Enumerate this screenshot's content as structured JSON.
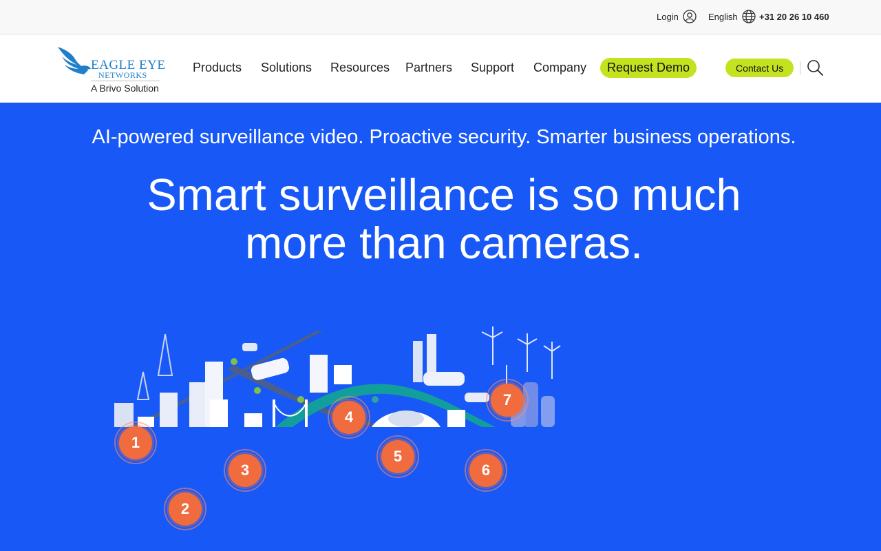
{
  "topbar": {
    "login_label": "Login",
    "language_label": "English",
    "phone": "+31 20 26 10 460"
  },
  "logo": {
    "line1": "EAGLE EYE",
    "line2": "NETWORKS",
    "line3": "A Brivo Solution"
  },
  "nav": {
    "items": [
      "Products",
      "Solutions",
      "Resources",
      "Partners",
      "Support",
      "Company"
    ],
    "request_demo": "Request Demo",
    "contact_us": "Contact Us"
  },
  "hero": {
    "tagline": "AI-powered surveillance video. Proactive security. Smarter business operations.",
    "headline_line1": "Smart surveillance is so much",
    "headline_line2": "more than cameras."
  },
  "markers": [
    "1",
    "2",
    "3",
    "4",
    "5",
    "6",
    "7"
  ],
  "colors": {
    "hero_background": "#1758f7",
    "accent_button": "#c5e21f",
    "marker": "#f06c3e",
    "logo_blue": "#1f7fc9"
  },
  "icons": [
    "user-icon",
    "globe-icon",
    "search-icon",
    "eagle-logo-icon"
  ]
}
